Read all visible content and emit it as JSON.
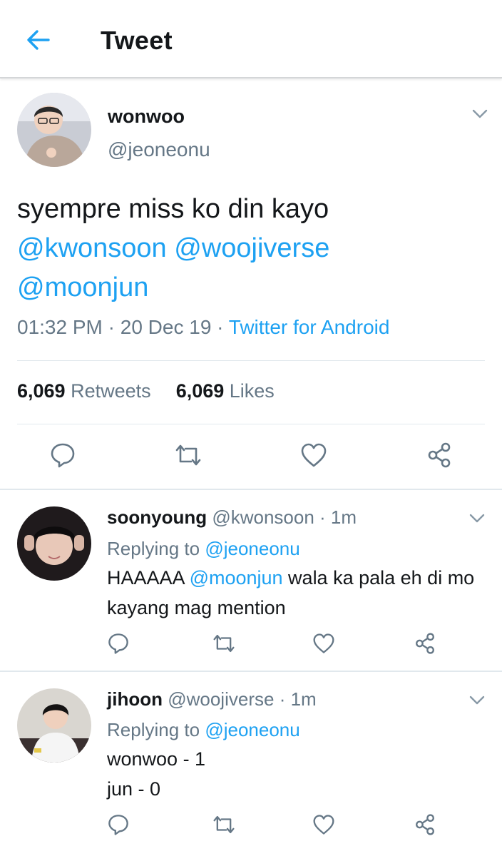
{
  "header": {
    "title": "Tweet"
  },
  "tweet": {
    "display_name": "wonwoo",
    "handle": "@jeoneonu",
    "text": "syempre miss ko din kayo",
    "mentions": [
      "@kwonsoon",
      "@woojiverse",
      "@moonjun"
    ],
    "time": "01:32 PM",
    "date": "20 Dec 19",
    "source": "Twitter for Android",
    "separator": " · ",
    "retweets_count": "6,069",
    "retweets_label": "Retweets",
    "likes_count": "6,069",
    "likes_label": "Likes"
  },
  "replies": [
    {
      "display_name": "soonyoung",
      "handle": "@kwonsoon",
      "age": "· 1m",
      "replying_label": "Replying to",
      "replying_handle": "@jeoneonu",
      "text_before": "HAAAAA ",
      "mention": "@moonjun",
      "text_after": " wala ka pala eh di mo kayang mag mention"
    },
    {
      "display_name": "jihoon",
      "handle": "@woojiverse",
      "age": "· 1m",
      "replying_label": "Replying to",
      "replying_handle": "@jeoneonu",
      "line1": "wonwoo - 1",
      "line2": "jun - 0"
    }
  ],
  "colors": {
    "accent": "#1da1f2",
    "secondary_text": "#657786",
    "divider": "#e1e8ed"
  },
  "icons": [
    "back-arrow-icon",
    "chevron-down-icon",
    "reply-icon",
    "retweet-icon",
    "like-icon",
    "share-icon"
  ]
}
